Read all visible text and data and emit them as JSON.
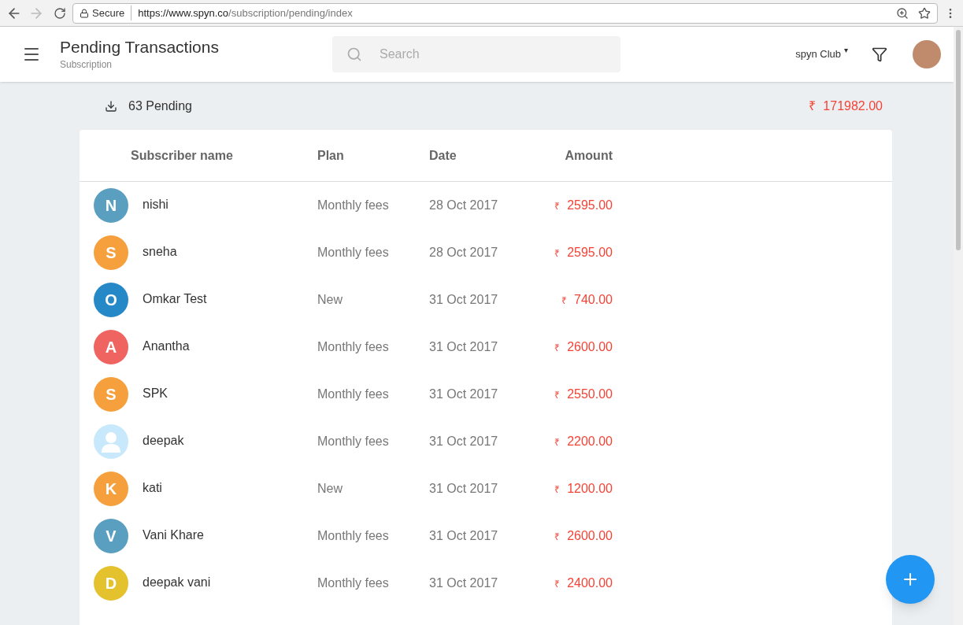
{
  "browser": {
    "secure_label": "Secure",
    "url_host": "https://www.spyn.co",
    "url_path": "/subscription/pending/index"
  },
  "header": {
    "title": "Pending Transactions",
    "subtitle": "Subscription",
    "search": {
      "placeholder": "Search"
    },
    "club": "spyn Club",
    "club_caret": "▾"
  },
  "summary": {
    "pending": "63 Pending",
    "currency": "₹",
    "total": "171982.00"
  },
  "table": {
    "columns": [
      "Subscriber name",
      "Plan",
      "Date",
      "Amount"
    ],
    "rows": [
      {
        "kind": "letter",
        "initial": "N",
        "color": "#5a9fbf",
        "name": "nishi",
        "plan": "Monthly fees",
        "date": "28 Oct 2017",
        "currency": "₹",
        "amount": "2595.00"
      },
      {
        "kind": "letter",
        "initial": "S",
        "color": "#f5a03c",
        "name": "sneha",
        "plan": "Monthly fees",
        "date": "28 Oct 2017",
        "currency": "₹",
        "amount": "2595.00"
      },
      {
        "kind": "letter",
        "initial": "O",
        "color": "#2589c8",
        "name": "Omkar Test",
        "plan": "New",
        "date": "31 Oct 2017",
        "currency": "₹",
        "amount": "740.00"
      },
      {
        "kind": "letter",
        "initial": "A",
        "color": "#ef6461",
        "name": "Anantha",
        "plan": "Monthly fees",
        "date": "31 Oct 2017",
        "currency": "₹",
        "amount": "2600.00"
      },
      {
        "kind": "letter",
        "initial": "S",
        "color": "#f5a03c",
        "name": "SPK",
        "plan": "Monthly fees",
        "date": "31 Oct 2017",
        "currency": "₹",
        "amount": "2550.00"
      },
      {
        "kind": "silhouette",
        "color": "#c8e8fb",
        "name": "deepak",
        "plan": "Monthly fees",
        "date": "31 Oct 2017",
        "currency": "₹",
        "amount": "2200.00"
      },
      {
        "kind": "letter",
        "initial": "K",
        "color": "#f5a03c",
        "name": "kati",
        "plan": "New",
        "date": "31 Oct 2017",
        "currency": "₹",
        "amount": "1200.00"
      },
      {
        "kind": "letter",
        "initial": "V",
        "color": "#5a9fbf",
        "name": "Vani Khare",
        "plan": "Monthly fees",
        "date": "31 Oct 2017",
        "currency": "₹",
        "amount": "2600.00"
      },
      {
        "kind": "letter",
        "initial": "D",
        "color": "#e3c22e",
        "name": "deepak vani",
        "plan": "Monthly fees",
        "date": "31 Oct 2017",
        "currency": "₹",
        "amount": "2400.00"
      }
    ]
  }
}
